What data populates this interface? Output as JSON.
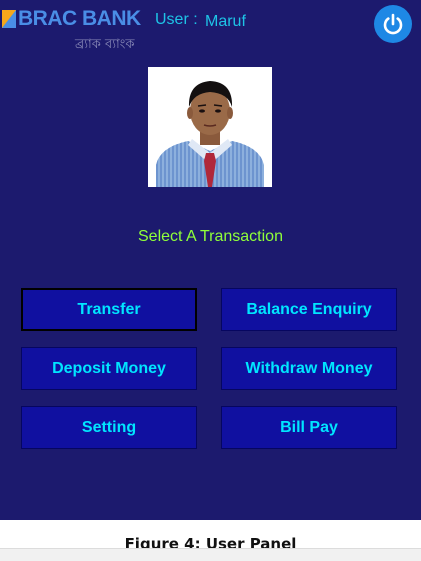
{
  "header": {
    "bank_name": "BRAC BANK",
    "bank_tagline": "ব্র্যাক ব্যাংক",
    "user_label": "User :",
    "user_name": "Maruf",
    "logout_icon": "power-icon"
  },
  "main": {
    "prompt": "Select A Transaction",
    "buttons": [
      {
        "label": "Transfer"
      },
      {
        "label": "Balance Enquiry"
      },
      {
        "label": "Deposit Money"
      },
      {
        "label": "Withdraw Money"
      },
      {
        "label": "Setting"
      },
      {
        "label": "Bill Pay"
      }
    ]
  },
  "caption": "Figure 4: User Panel",
  "colors": {
    "panel_bg": "#1c1a6e",
    "button_bg": "#1010a0",
    "button_text": "#00e5ff",
    "prompt_text": "#8fff3a",
    "user_text": "#1ec3e6",
    "logo_text": "#4a8ee6",
    "power_button": "#1e88e5"
  }
}
